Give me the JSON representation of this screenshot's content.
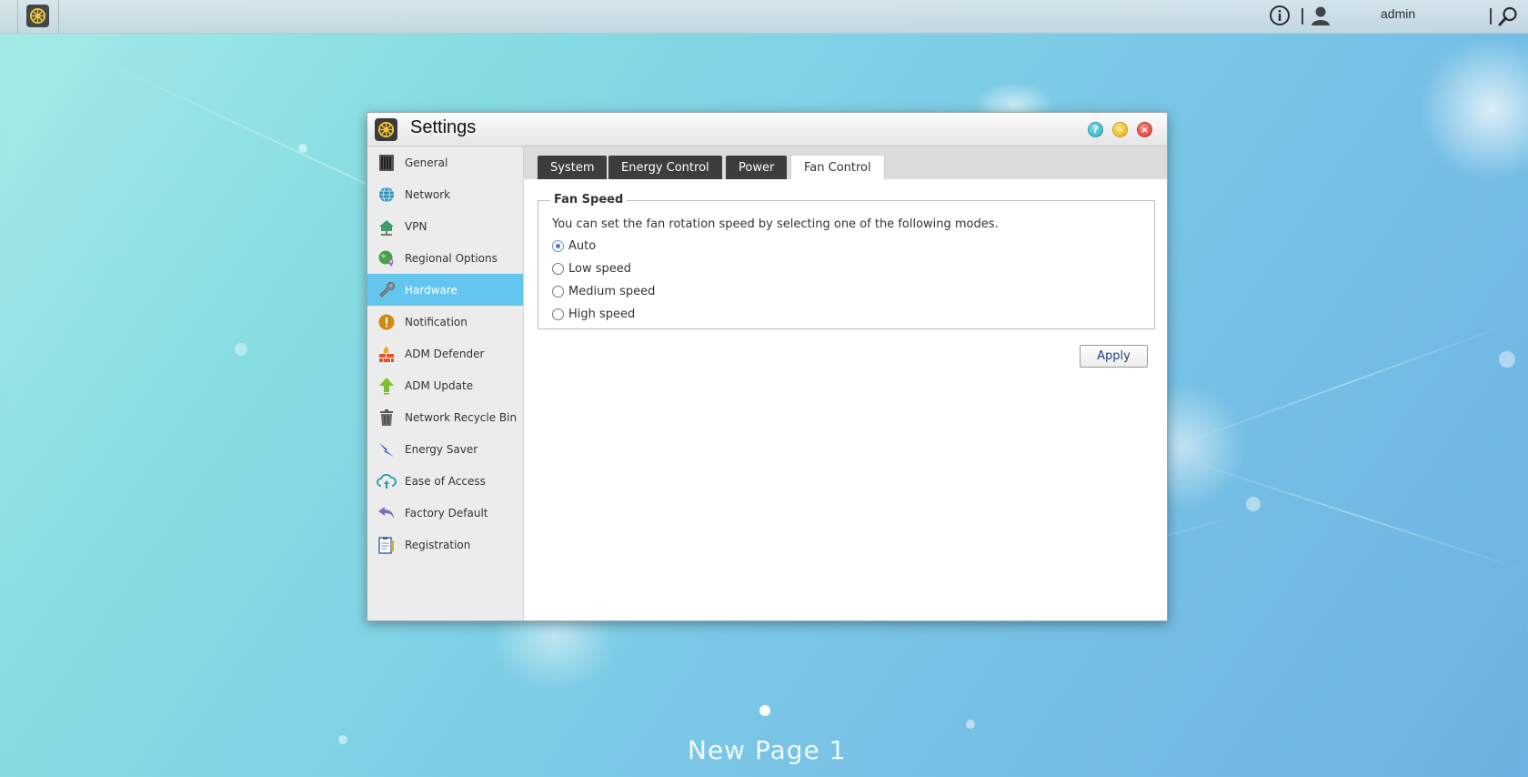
{
  "topbar": {
    "username": "admin"
  },
  "window": {
    "title": "Settings"
  },
  "sidebar": {
    "items": [
      {
        "label": "General",
        "icon": "server-icon"
      },
      {
        "label": "Network",
        "icon": "globe-icon"
      },
      {
        "label": "VPN",
        "icon": "house-network-icon"
      },
      {
        "label": "Regional Options",
        "icon": "globe-pin-icon"
      },
      {
        "label": "Hardware",
        "icon": "wrench-icon"
      },
      {
        "label": "Notification",
        "icon": "alert-icon"
      },
      {
        "label": "ADM Defender",
        "icon": "firewall-icon"
      },
      {
        "label": "ADM Update",
        "icon": "arrow-up-icon"
      },
      {
        "label": "Network Recycle Bin",
        "icon": "trash-icon"
      },
      {
        "label": "Energy Saver",
        "icon": "lightning-icon"
      },
      {
        "label": "Ease of Access",
        "icon": "cloud-upload-icon"
      },
      {
        "label": "Factory Default",
        "icon": "undo-icon"
      },
      {
        "label": "Registration",
        "icon": "clipboard-icon"
      }
    ],
    "active": "Hardware"
  },
  "tabs": [
    {
      "label": "System"
    },
    {
      "label": "Energy Control"
    },
    {
      "label": "Power"
    },
    {
      "label": "Fan Control"
    }
  ],
  "active_tab": "Fan Control",
  "fan_speed": {
    "legend": "Fan Speed",
    "description": "You can set the fan rotation speed by selecting one of the following modes.",
    "options": [
      {
        "label": "Auto",
        "checked": true
      },
      {
        "label": "Low speed",
        "checked": false
      },
      {
        "label": "Medium speed",
        "checked": false
      },
      {
        "label": "High speed",
        "checked": false
      }
    ]
  },
  "apply_label": "Apply",
  "desktop": {
    "page_label": "New Page 1"
  },
  "colors": {
    "active_sidebar": "#64c6ef",
    "tab_dark": "#3d3d3d"
  }
}
